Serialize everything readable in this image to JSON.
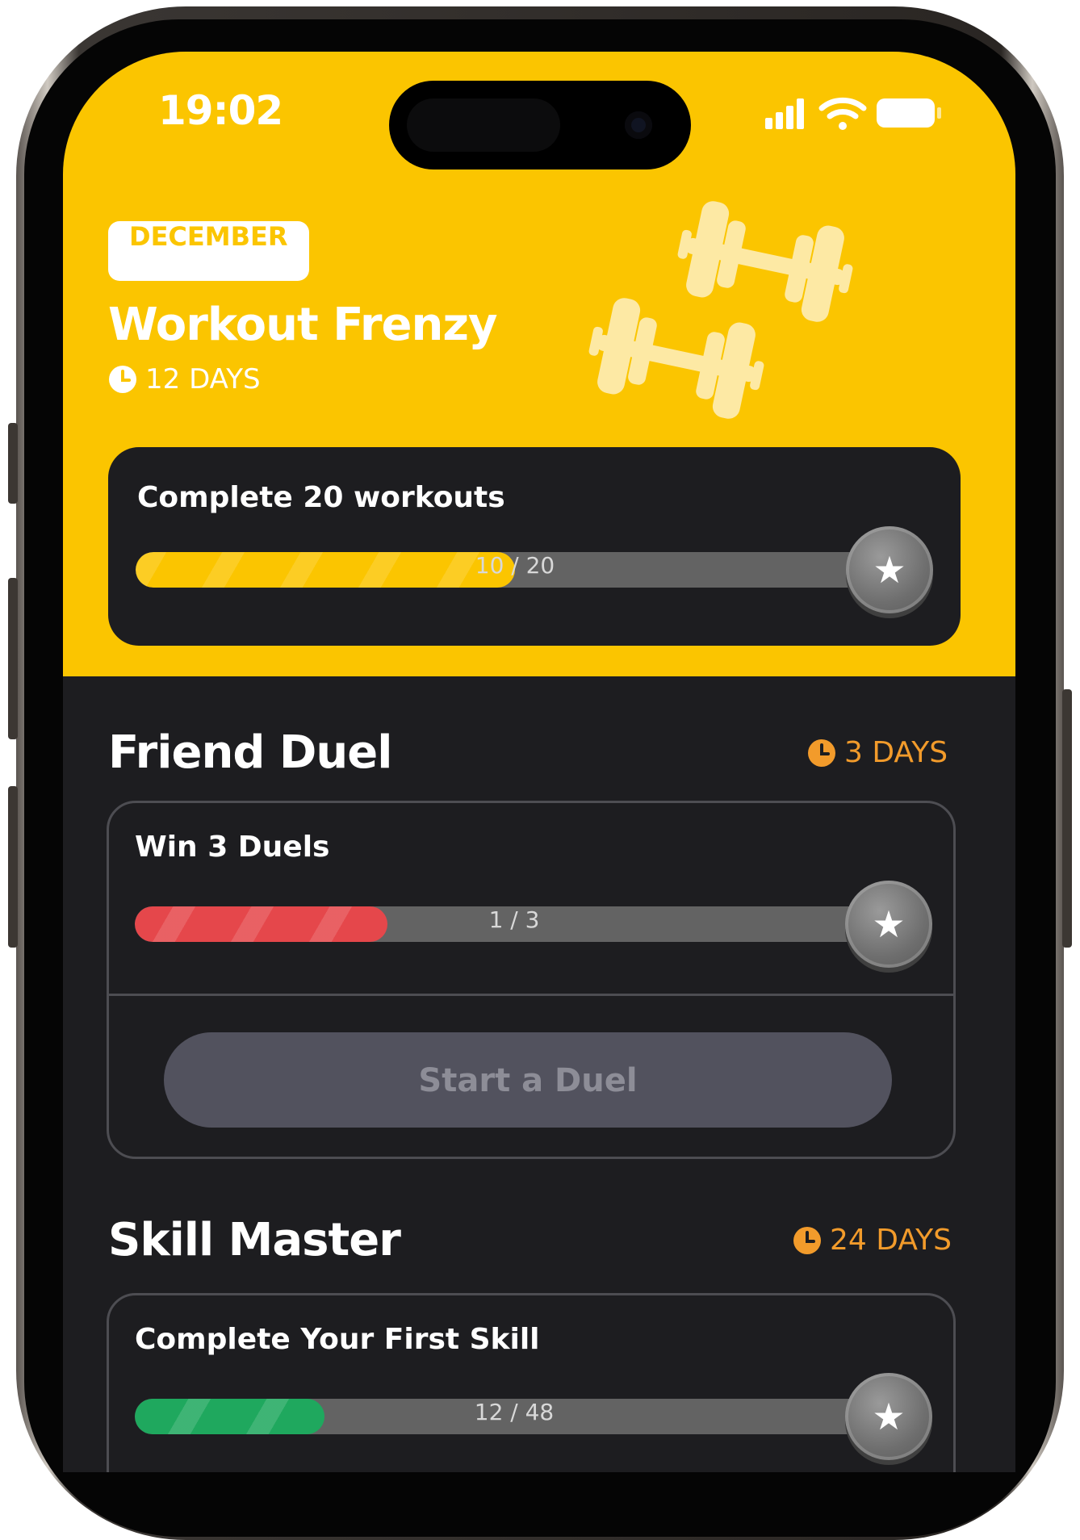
{
  "status_bar": {
    "time": "19:02"
  },
  "hero": {
    "month_badge": "DECEMBER",
    "title": "Workout Frenzy",
    "time_left": "12 DAYS",
    "goal": {
      "title": "Complete 20 workouts",
      "progress_label": "10 / 20",
      "progress_fraction": 0.5,
      "color": "#fbc500"
    }
  },
  "sections": [
    {
      "title": "Friend Duel",
      "time_left": "3 DAYS",
      "goal": {
        "title": "Win 3 Duels",
        "progress_label": "1 / 3",
        "progress_fraction": 0.333,
        "color": "#e5474b"
      },
      "action_label": "Start a Duel"
    },
    {
      "title": "Skill Master",
      "time_left": "24 DAYS",
      "goal": {
        "title": "Complete Your First Skill",
        "progress_label": "12 / 48",
        "progress_fraction": 0.25,
        "color": "#1fa85e"
      }
    }
  ],
  "colors": {
    "brand_yellow": "#fbc500",
    "background": "#1d1d20",
    "accent_orange": "#f29b2b"
  },
  "icons": {
    "clock": "clock-icon",
    "star": "star-icon",
    "dumbbell": "dumbbell-icon",
    "signal": "signal-icon",
    "wifi": "wifi-icon",
    "battery": "battery-icon"
  }
}
